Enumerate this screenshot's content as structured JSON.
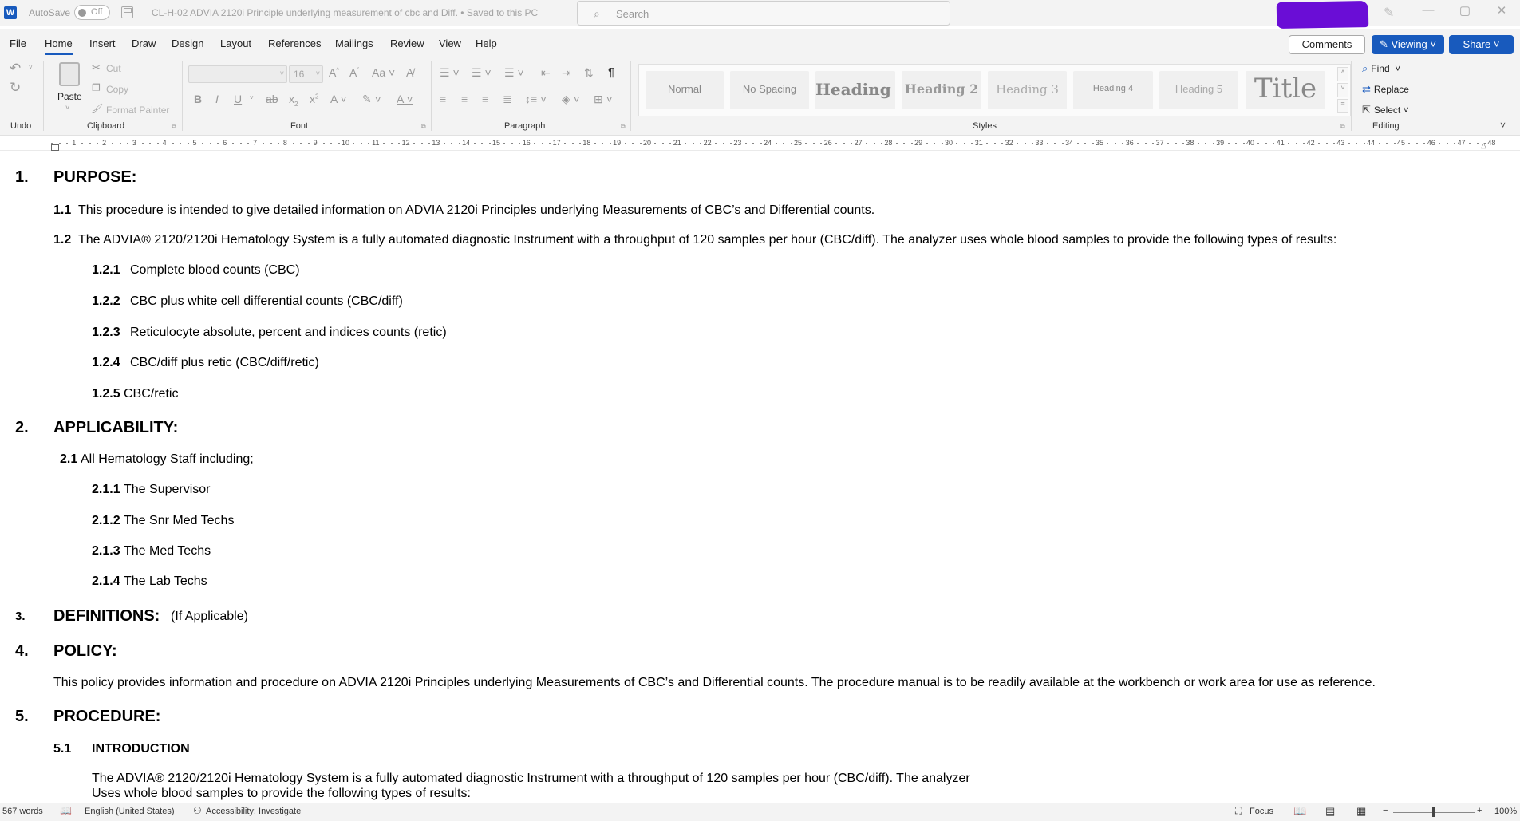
{
  "titlebar": {
    "logo": "W",
    "autosave_label": "AutoSave",
    "autosave_state": "Off",
    "doc_title": "CL-H-02 ADVIA 2120i Principle underlying measurement of cbc and Diff. • Saved to this PC",
    "search_placeholder": "Search",
    "minimize": "—",
    "maximize": "▢",
    "close": "✕"
  },
  "tabs": [
    "File",
    "Home",
    "Insert",
    "Draw",
    "Design",
    "Layout",
    "References",
    "Mailings",
    "Review",
    "View",
    "Help"
  ],
  "actions": {
    "comments": "Comments",
    "viewing": "Viewing",
    "share": "Share"
  },
  "ribbon": {
    "undo_group": "Undo",
    "clipboard": {
      "label": "Clipboard",
      "paste": "Paste",
      "cut": "Cut",
      "copy": "Copy",
      "format_painter": "Format Painter"
    },
    "font": {
      "label": "Font",
      "size": "16"
    },
    "paragraph_label": "Paragraph",
    "styles": {
      "label": "Styles",
      "items": [
        "Normal",
        "No Spacing",
        "Heading 1",
        "Heading 2",
        "Heading 3",
        "Heading 4",
        "Heading 5",
        "Title"
      ]
    },
    "editing": {
      "label": "Editing",
      "find": "Find",
      "replace": "Replace",
      "select": "Select"
    }
  },
  "ruler_numbers": [
    "1",
    "2",
    "3",
    "4",
    "5",
    "6",
    "7",
    "8",
    "9",
    "10",
    "11",
    "12",
    "13",
    "14",
    "15",
    "16",
    "17",
    "18",
    "19",
    "20",
    "21",
    "22",
    "23",
    "24",
    "25",
    "26",
    "27",
    "28",
    "29",
    "30",
    "31",
    "32",
    "33",
    "34",
    "35",
    "36",
    "37",
    "38",
    "39",
    "40",
    "41",
    "42",
    "43",
    "44",
    "45",
    "46",
    "47",
    "48"
  ],
  "document": {
    "s1_num": "1.",
    "s1_title": "PURPOSE:",
    "p11_num": "1.1",
    "p11_text": "This procedure is intended to give detailed information on ADVIA 2120i Principles underlying Measurements of CBC’s and Differential counts.",
    "p12_num": "1.2",
    "p12_text": "The ADVIA® 2120/2120i Hematology System is a fully automated diagnostic Instrument with a throughput of 120 samples per hour (CBC/diff). The analyzer uses whole blood samples to provide the following types of results:",
    "p121_num": "1.2.1",
    "p121_text": "Complete blood counts (CBC)",
    "p122_num": "1.2.2",
    "p122_text": "CBC plus white cell differential counts (CBC/diff)",
    "p123_num": "1.2.3",
    "p123_text": "Reticulocyte absolute, percent and indices counts (retic)",
    "p124_num": "1.2.4",
    "p124_text": "CBC/diff plus retic (CBC/diff/retic)",
    "p125_num": "1.2.5",
    "p125_text": "CBC/retic",
    "s2_num": "2.",
    "s2_title": "APPLICABILITY:",
    "p21_num": "2.1",
    "p21_text": "All Hematology Staff including;",
    "p211_num": "2.1.1",
    "p211_text": "The Supervisor",
    "p212_num": "2.1.2",
    "p212_text": "The Snr Med Techs",
    "p213_num": "2.1.3",
    "p213_text": "The Med Techs",
    "p214_num": "2.1.4",
    "p214_text": "The Lab Techs",
    "s3_num": "3.",
    "s3_title": "DEFINITIONS:",
    "s3_note": "(If Applicable)",
    "s4_num": "4.",
    "s4_title": "POLICY:",
    "policy_text": "This policy provides information and procedure on ADVIA 2120i Principles underlying Measurements of CBC’s and Differential counts. The procedure manual is to be readily available at the workbench or work area for use as reference.",
    "s5_num": "5.",
    "s5_title": "PROCEDURE:",
    "p51_num": "5.1",
    "p51_title": "INTRODUCTION",
    "intro_line1": "The ADVIA® 2120/2120i Hematology System is a fully automated diagnostic Instrument with a throughput of 120 samples per hour (CBC/diff). The analyzer",
    "intro_line2": "Uses whole blood samples to provide the following types of results:"
  },
  "status": {
    "words": "567 words",
    "language": "English (United States)",
    "accessibility": "Accessibility: Investigate",
    "focus": "Focus",
    "zoom": "100%"
  }
}
